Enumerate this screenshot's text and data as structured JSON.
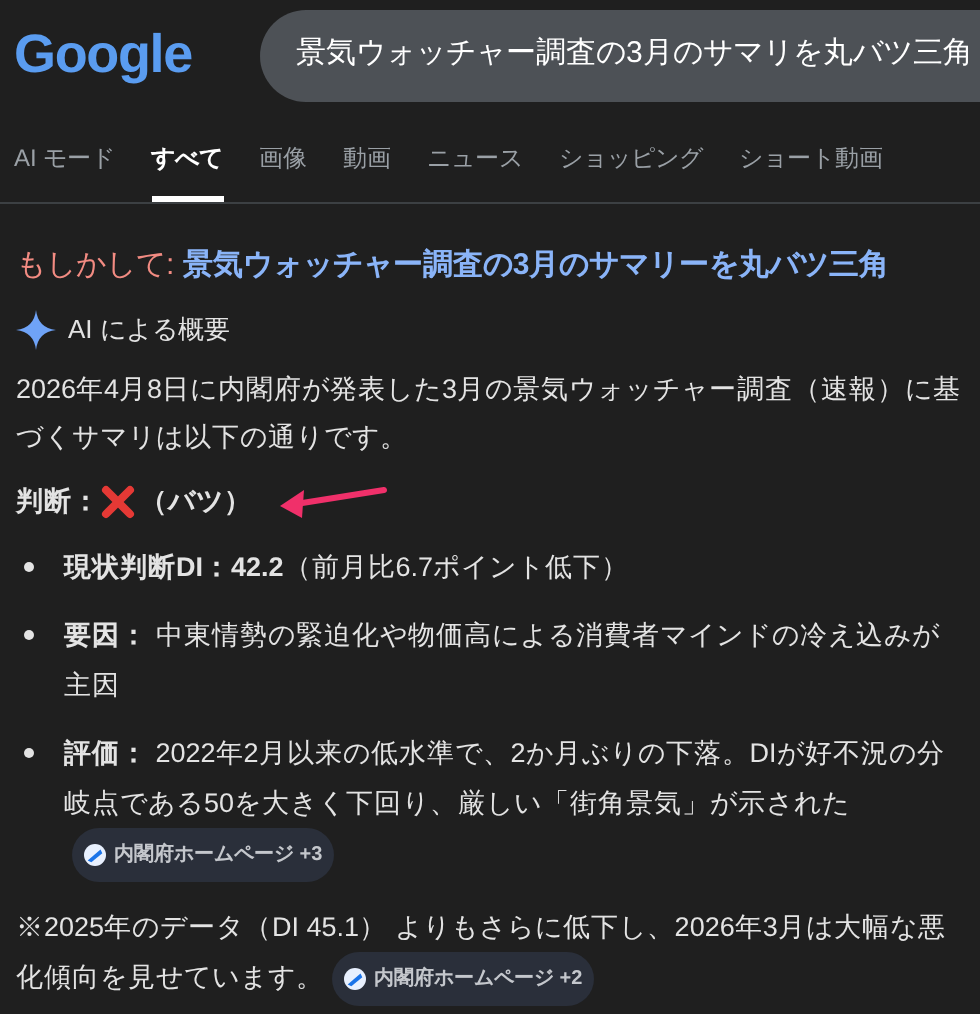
{
  "logo": "Google",
  "search": {
    "value": "景気ウォッチャー調査の3月のサマリを丸バツ三角"
  },
  "tabs": [
    {
      "label": "AI モード",
      "selected": false
    },
    {
      "label": "すべて",
      "selected": true
    },
    {
      "label": "画像",
      "selected": false
    },
    {
      "label": "動画",
      "selected": false
    },
    {
      "label": "ニュース",
      "selected": false
    },
    {
      "label": "ショッピング",
      "selected": false
    },
    {
      "label": "ショート動画",
      "selected": false
    }
  ],
  "did_you_mean": {
    "prefix": "もしかして:",
    "suggestion": "景気ウォッチャー調査の3月のサマリーを丸バツ三角"
  },
  "ai_overview": {
    "title": "AI による概要",
    "intro": "2026年4月8日に内閣府が発表した3月の景気ウォッチャー調査（速報）に基づくサマリは以下の通りです。",
    "verdict": {
      "label": "判断：",
      "reading": "（バツ）"
    },
    "bullets": [
      {
        "text": "**現状判断DI：42.2**（前月比6.7ポイント低下）"
      },
      {
        "text": "**要因：** 中東情勢の緊迫化や物価高による消費者マインドの冷え込みが主因"
      },
      {
        "text": "**評価：** 2022年2月以来の低水準で、2か月ぶりの下落。DIが好不況の分岐点である50を大きく下回り、厳しい「街角景気」が示された",
        "source": "内閣府ホームページ +3"
      }
    ],
    "note": {
      "text": "※2025年のデータ（DI 45.1） よりもさらに低下し、2026年3月は大幅な悪化傾向を見せています。",
      "source": "内閣府ホームページ +2"
    }
  }
}
